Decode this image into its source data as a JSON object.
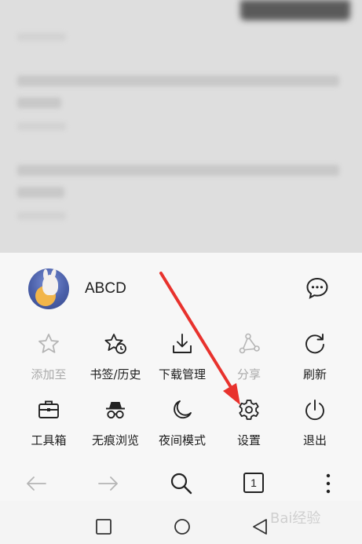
{
  "profile": {
    "username": "ABCD"
  },
  "menu_row1": [
    {
      "label": "添加至",
      "icon": "star-icon",
      "enabled": false
    },
    {
      "label": "书签/历史",
      "icon": "bookmark-history-icon",
      "enabled": true
    },
    {
      "label": "下载管理",
      "icon": "download-icon",
      "enabled": true
    },
    {
      "label": "分享",
      "icon": "share-icon",
      "enabled": false
    },
    {
      "label": "刷新",
      "icon": "refresh-icon",
      "enabled": true
    }
  ],
  "menu_row2": [
    {
      "label": "工具箱",
      "icon": "toolbox-icon",
      "enabled": true
    },
    {
      "label": "无痕浏览",
      "icon": "incognito-icon",
      "enabled": true
    },
    {
      "label": "夜间模式",
      "icon": "moon-icon",
      "enabled": true
    },
    {
      "label": "设置",
      "icon": "gear-icon",
      "enabled": true
    },
    {
      "label": "退出",
      "icon": "power-icon",
      "enabled": true
    }
  ],
  "bottom_bar": {
    "tab_count": "1"
  },
  "watermark": "Bai经验",
  "colors": {
    "icon": "#222222",
    "disabled": "#b5b5b5",
    "arrow": "#e8322d"
  }
}
